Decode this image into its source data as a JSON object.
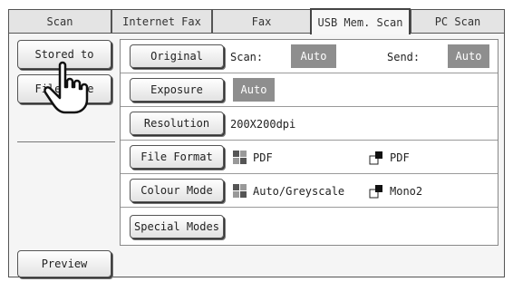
{
  "tabs": [
    {
      "label": "Scan",
      "active": false
    },
    {
      "label": "Internet Fax",
      "active": false
    },
    {
      "label": "Fax",
      "active": false
    },
    {
      "label": "USB Mem. Scan",
      "active": true
    },
    {
      "label": "PC Scan",
      "active": false
    }
  ],
  "sidebar": {
    "stored_to": "Stored to",
    "file_name": "File Name",
    "preview": "Preview"
  },
  "settings": {
    "original": {
      "button": "Original",
      "scan_label": "Scan:",
      "scan_value": "Auto",
      "send_label": "Send:",
      "send_value": "Auto"
    },
    "exposure": {
      "button": "Exposure",
      "value": "Auto"
    },
    "resolution": {
      "button": "Resolution",
      "value": "200X200dpi"
    },
    "file_format": {
      "button": "File Format",
      "colour_value": "PDF",
      "mono_value": "PDF"
    },
    "colour_mode": {
      "button": "Colour Mode",
      "colour_value": "Auto/Greyscale",
      "mono_value": "Mono2"
    },
    "special_modes": {
      "button": "Special Modes"
    }
  },
  "icons": {
    "pointer": "pointing-hand-icon",
    "colour": "colour-grid-icon",
    "mono": "mono-square-icon"
  },
  "colors": {
    "tag_bg": "#8e8e8e",
    "panel_bg": "#f5f5f5"
  }
}
